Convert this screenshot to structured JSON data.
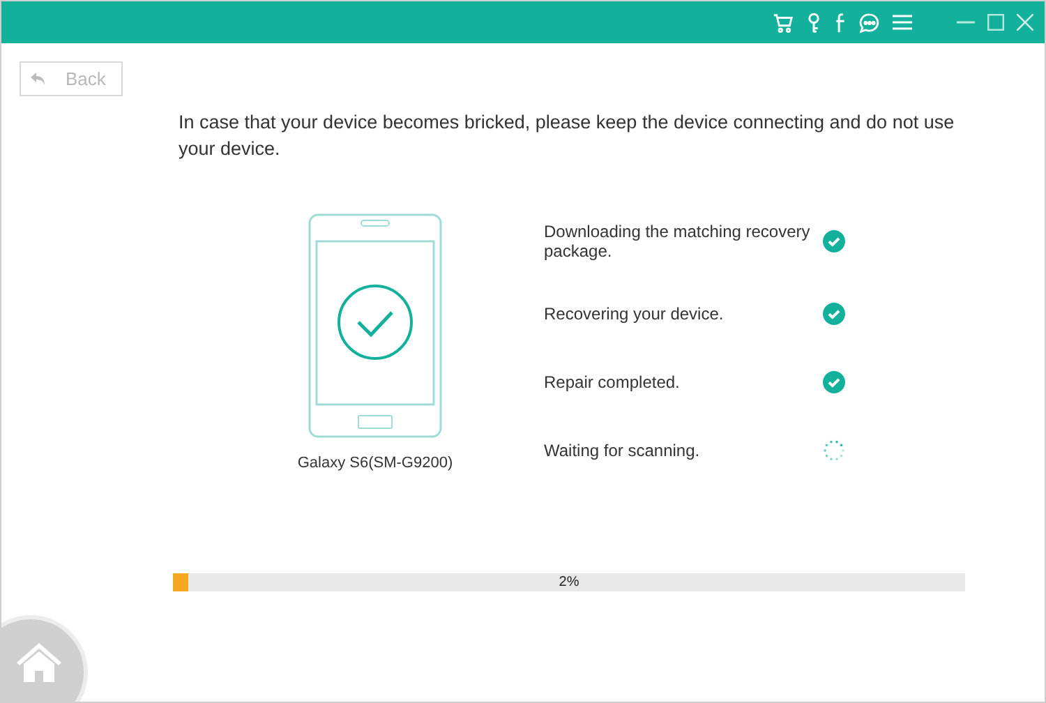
{
  "back_button": {
    "label": "Back"
  },
  "message": "In case that your device becomes bricked, please keep the device connecting and do not use your device.",
  "device": {
    "name": "Galaxy S6(SM-G9200)"
  },
  "steps": [
    {
      "label": "Downloading the matching recovery package.",
      "kind": "done"
    },
    {
      "label": "Recovering your device.",
      "kind": "done"
    },
    {
      "label": "Repair completed.",
      "kind": "done"
    },
    {
      "label": "Waiting for scanning.",
      "kind": "pending"
    }
  ],
  "progress": {
    "level": 0.02,
    "reading": "2%"
  }
}
